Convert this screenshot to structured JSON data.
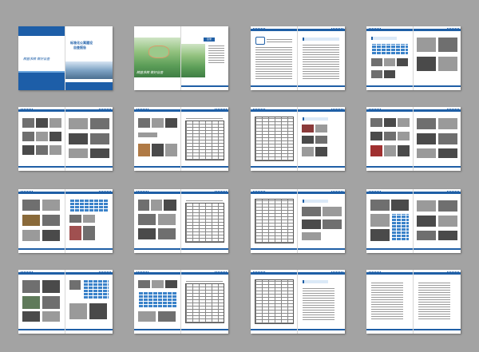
{
  "cover": {
    "title_line1": "标准化公寓建设",
    "title_line2": "自查报告",
    "slogan_left": "精益求精  做好自查",
    "slogan_right": "精益求精  做好自查"
  },
  "toc": {
    "label": "目录"
  },
  "colors": {
    "background": "#a3a3a3",
    "accent_blue": "#1f5fa6",
    "light_blue": "#6aa6de",
    "page": "#ffffff"
  },
  "layout": {
    "spread_count": 16,
    "rows": 4,
    "columns": 4
  }
}
